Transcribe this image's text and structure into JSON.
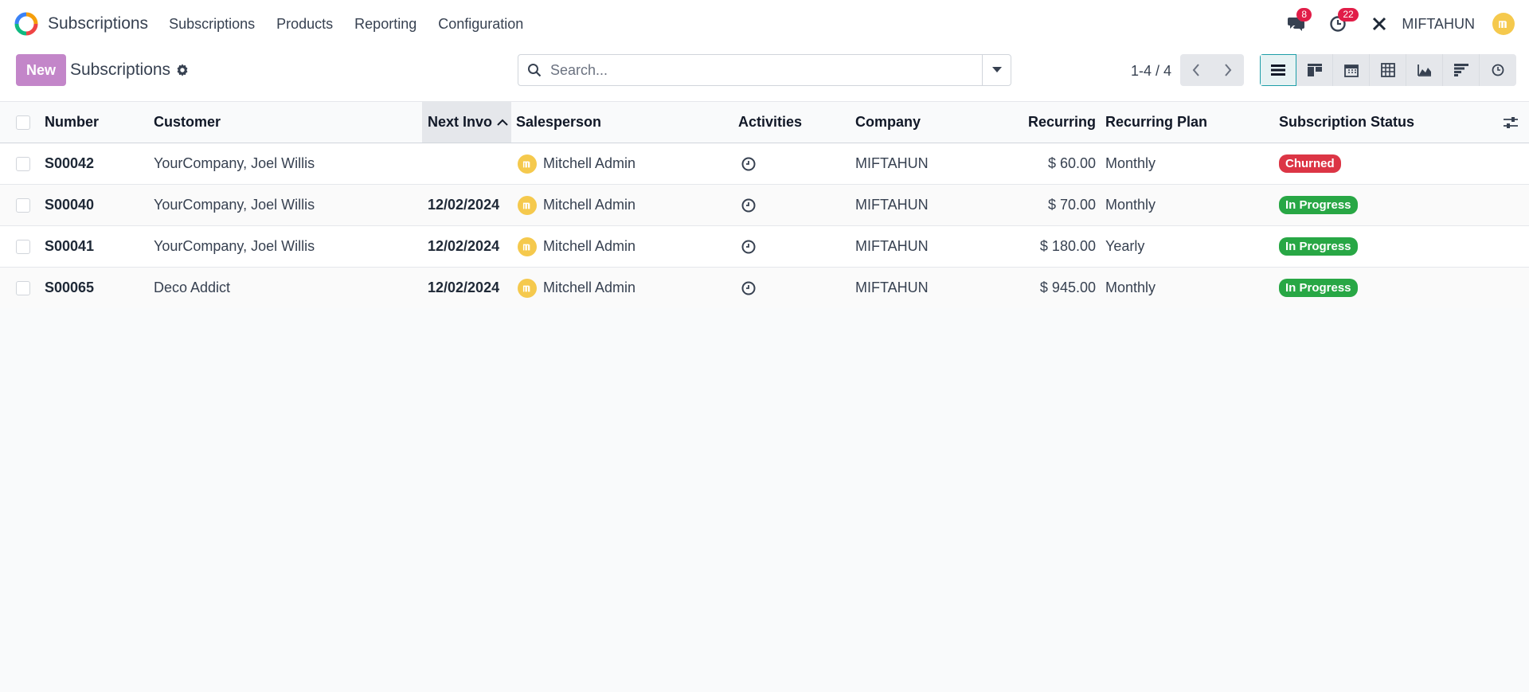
{
  "topbar": {
    "app_name": "Subscriptions",
    "menu": [
      "Subscriptions",
      "Products",
      "Reporting",
      "Configuration"
    ],
    "messages_count": "8",
    "activities_count": "22",
    "company": "MIFTAHUN"
  },
  "control": {
    "new_label": "New",
    "breadcrumb": "Subscriptions",
    "search_placeholder": "Search...",
    "pager": "1-4 / 4"
  },
  "table": {
    "headers": {
      "number": "Number",
      "customer": "Customer",
      "next_invoice": "Next Invo",
      "salesperson": "Salesperson",
      "activities": "Activities",
      "company": "Company",
      "recurring": "Recurring",
      "recurring_plan": "Recurring Plan",
      "status": "Subscription Status"
    },
    "rows": [
      {
        "number": "S00042",
        "customer": "YourCompany, Joel Willis",
        "next_invoice": "",
        "salesperson": "Mitchell Admin",
        "company": "MIFTAHUN",
        "recurring": "$ 60.00",
        "plan": "Monthly",
        "status": "Churned"
      },
      {
        "number": "S00040",
        "customer": "YourCompany, Joel Willis",
        "next_invoice": "12/02/2024",
        "salesperson": "Mitchell Admin",
        "company": "MIFTAHUN",
        "recurring": "$ 70.00",
        "plan": "Monthly",
        "status": "In Progress"
      },
      {
        "number": "S00041",
        "customer": "YourCompany, Joel Willis",
        "next_invoice": "12/02/2024",
        "salesperson": "Mitchell Admin",
        "company": "MIFTAHUN",
        "recurring": "$ 180.00",
        "plan": "Yearly",
        "status": "In Progress"
      },
      {
        "number": "S00065",
        "customer": "Deco Addict",
        "next_invoice": "12/02/2024",
        "salesperson": "Mitchell Admin",
        "company": "MIFTAHUN",
        "recurring": "$ 945.00",
        "plan": "Monthly",
        "status": "In Progress"
      }
    ]
  },
  "colors": {
    "primary": "#c386c9",
    "churned": "#dc3545",
    "in_progress": "#28a745"
  }
}
